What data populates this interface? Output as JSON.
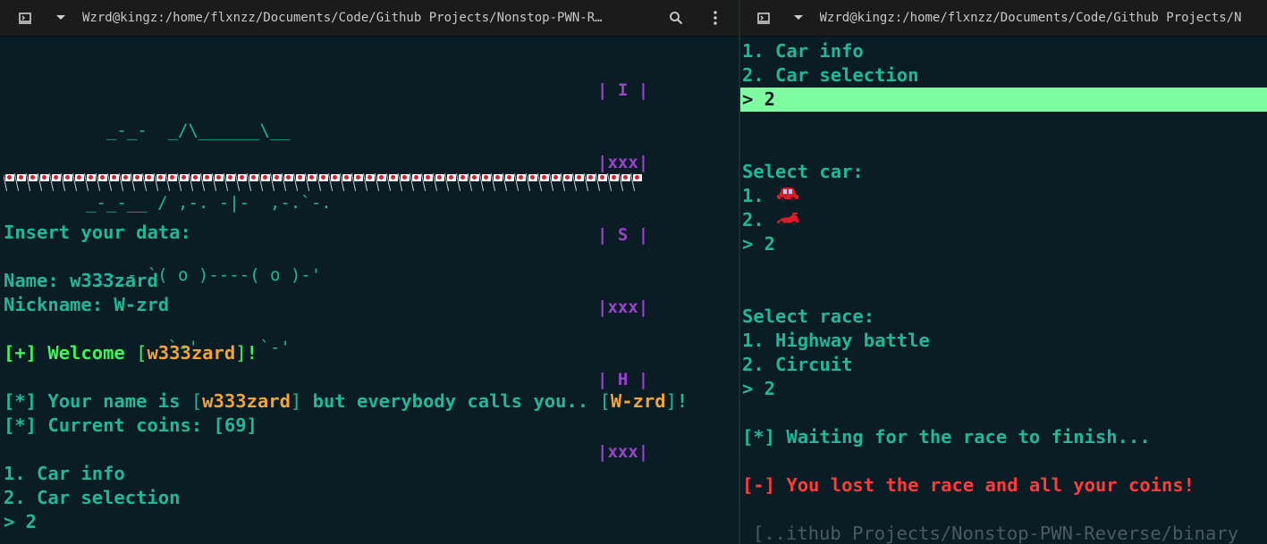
{
  "left": {
    "titlebar": {
      "title": "Wzrd@kingz:/home/flxnzz/Documents/Code/Github Projects/Nonstop-PWN-R…"
    },
    "ascii_art": [
      "         _-_-  _/\\______\\__",
      "       _-_-__ / ,-. -|-  ,-.`-.",
      "        _-_- `( o )----( o )-'",
      "               `-'      `-'"
    ],
    "tower": [
      "| I |",
      "|xxx|",
      "| S |",
      "|xxx|",
      "| H |",
      "|xxx|"
    ],
    "flag_count": 55,
    "prompt_insert": "Insert your data:",
    "name_label": "Name: ",
    "name_value": "w333zard",
    "nickname_label": "Nickname: ",
    "nickname_value": "W-zrd",
    "welcome": {
      "tag": "[+]",
      "text_before": " Welcome ",
      "name": "w333zard",
      "text_after": "!"
    },
    "info1": {
      "tag": "[*]",
      "text_before": " Your name is ",
      "name": "w333zard",
      "text_mid": " but everybody calls you.. ",
      "nick": "W-zrd",
      "text_after": "!"
    },
    "info2": {
      "tag": "[*]",
      "text": " Current coins: [69]"
    },
    "menu": [
      "1. Car info",
      "2. Car selection"
    ],
    "input": "> 2"
  },
  "right": {
    "titlebar": {
      "title": "Wzrd@kingz:/home/flxnzz/Documents/Code/Github Projects/N"
    },
    "menu": [
      "1. Car info",
      "2. Car selection"
    ],
    "input_highlighted": "> 2",
    "select_car": "Select car:",
    "car_options": [
      "1. ",
      "2. "
    ],
    "car_icons": [
      "red-car-icon",
      "race-car-icon"
    ],
    "car_input": "> 2",
    "select_race": "Select race:",
    "race_options": [
      "1. Highway battle",
      "2. Circuit"
    ],
    "race_input": "> 2",
    "waiting": {
      "tag": "[*]",
      "text": " Waiting for the race to finish..."
    },
    "lost": {
      "tag": "[-]",
      "text": " You lost the race and all your coins!"
    },
    "cwd_prompt": "[..ithub Projects/Nonstop-PWN-Reverse/binary"
  },
  "colors": {
    "background": "#0b1d24",
    "teal": "#21b89a",
    "green": "#46ef60",
    "orange": "#f0a43a",
    "red": "#ff3b3b",
    "purple": "#9a44cc",
    "highlight": "#7efca0"
  }
}
